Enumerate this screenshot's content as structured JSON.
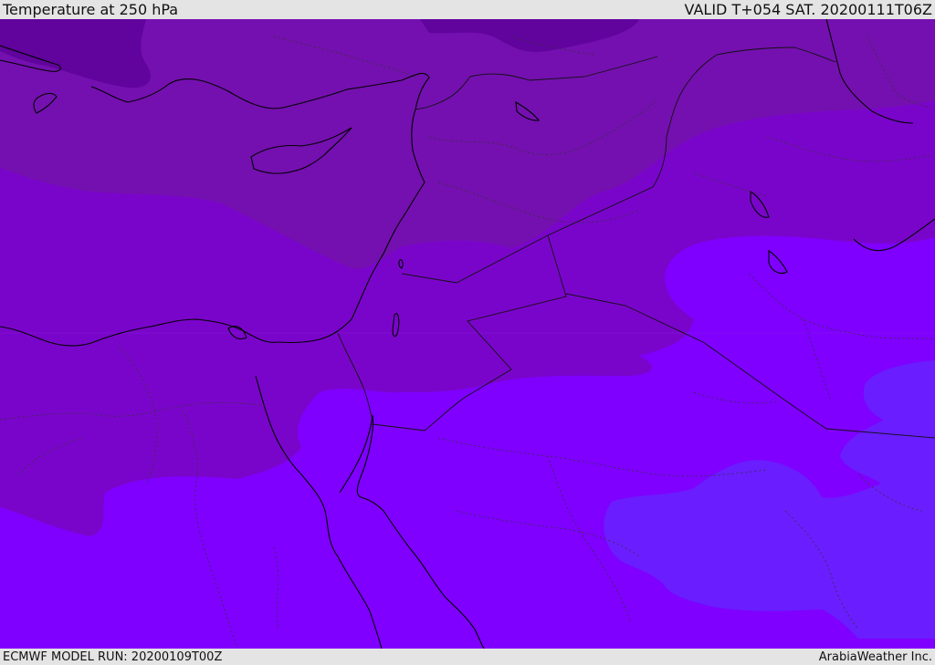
{
  "header": {
    "title": "Temperature at 250 hPa",
    "valid_time": "VALID T+054 SAT. 20200111T06Z"
  },
  "footer": {
    "model_run": "ECMWF MODEL RUN: 20200109T00Z",
    "credit": "ArabiaWeather Inc."
  },
  "colors": {
    "band_coldest": "#61039d",
    "band_cold": "#7410af",
    "band_mid": "#7a05ca",
    "band_warm": "#7f00ff",
    "band_warmest": "#6a1dff",
    "coastline": "#000000",
    "border": "#222222"
  }
}
